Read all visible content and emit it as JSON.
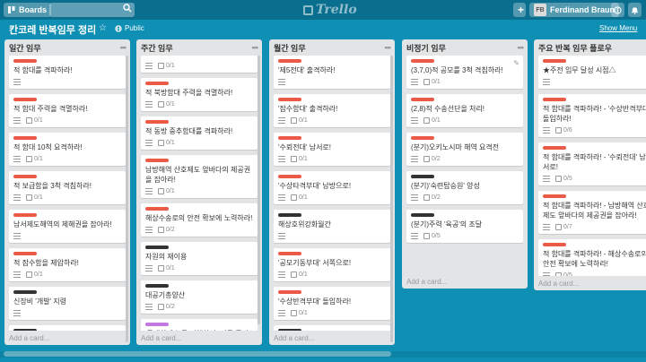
{
  "topbar": {
    "boards_label": "Boards",
    "logo_text": "Trello",
    "user_initials": "FB",
    "user_name": "Ferdinand Braun"
  },
  "board": {
    "title": "칸코레 반복임무 정리",
    "visibility": "Public",
    "show_menu": "Show Menu"
  },
  "add_card_label": "Add a card...",
  "lists": [
    {
      "name": "일간 임무",
      "cards": [
        {
          "label": "red",
          "title": "적 함대를 격파하라!",
          "desc": true,
          "check": null
        },
        {
          "label": "red",
          "title": "적 함대 주력을 격멸하라!",
          "desc": true,
          "check": "0/1"
        },
        {
          "label": "red",
          "title": "적 함대 10척 요격하라!",
          "desc": true,
          "check": "0/1"
        },
        {
          "label": "red",
          "title": "적 보급함을 3척 격침하라!",
          "desc": true,
          "check": "0/1"
        },
        {
          "label": "red",
          "title": "남서제도해역의 제해권을 잡아라!",
          "desc": true,
          "check": null
        },
        {
          "label": "red",
          "title": "적 잠수함을 제압하라!",
          "desc": true,
          "check": "0/1"
        },
        {
          "label": "black",
          "title": "신장비 '개발' 지령",
          "desc": true,
          "check": null
        },
        {
          "label": "black",
          "title": "신조함 '건조' 지령",
          "desc": false,
          "check": null
        }
      ]
    },
    {
      "name": "주간 임무",
      "cards": [
        {
          "label": null,
          "title": "",
          "desc": true,
          "check": "0/1"
        },
        {
          "label": "red",
          "title": "적 북방함대 주력을 격멸하라!",
          "desc": true,
          "check": "0/1"
        },
        {
          "label": "red",
          "title": "적 동방 중추함대를 격파하라!",
          "desc": true,
          "check": "0/1"
        },
        {
          "label": "red",
          "title": "남방해역 산호제도 앞바다의 제공권을 잡아라!",
          "desc": true,
          "check": "0/1"
        },
        {
          "label": "red",
          "title": "해상수송로의 안전 확보에 노력하라!",
          "desc": true,
          "check": "0/2"
        },
        {
          "label": "black",
          "title": "자원의 재이용",
          "desc": true,
          "check": "0/1"
        },
        {
          "label": "black",
          "title": "대공기총양산",
          "desc": true,
          "check": "0/2"
        },
        {
          "label": "purple",
          "title": "'근대화개수'를 진행하여, 전투 준비를 갖춰라!",
          "desc": false,
          "check": null
        }
      ]
    },
    {
      "name": "월간 임무",
      "cards": [
        {
          "label": "red",
          "title": "'제5전대' 출격하라!",
          "desc": true,
          "check": null
        },
        {
          "label": "red",
          "title": "'잠수함대' 출격하라!",
          "desc": true,
          "check": "0/1"
        },
        {
          "label": "red",
          "title": "'수뢰전대' 남서로!",
          "desc": true,
          "check": "0/1"
        },
        {
          "label": "red",
          "title": "'수상타격부대' 남방으로!",
          "desc": true,
          "check": "0/1"
        },
        {
          "label": "black",
          "title": "해상호위강화월간",
          "desc": true,
          "check": null
        },
        {
          "label": "red",
          "title": "'공모기동부대' 서쪽으로!",
          "desc": true,
          "check": "0/1"
        },
        {
          "label": "red",
          "title": "'수상반격부대' 돌입하라!",
          "desc": true,
          "check": "0/1"
        },
        {
          "label": "black",
          "title": "정예 '함전'대의 신 편성",
          "desc": false,
          "check": null
        }
      ]
    },
    {
      "name": "비정기 임무",
      "cards": [
        {
          "label": "red",
          "title": "(3,7,0)적 공모를 3척 격침하라!",
          "desc": true,
          "check": "0/1"
        },
        {
          "label": "red",
          "title": "(2,8)적 수송선단을 처리!",
          "desc": true,
          "check": "0/1"
        },
        {
          "label": "red",
          "title": "(분기)오키노시마 해역 요격전",
          "desc": true,
          "check": "0/2"
        },
        {
          "label": "black",
          "title": "(분기)'숙련탑승원' 양성",
          "desc": true,
          "check": "0/2"
        },
        {
          "label": "black",
          "title": "(분기)주력 '육공'의 조달",
          "desc": true,
          "check": "0/5"
        }
      ]
    },
    {
      "name": "주요 반복 임무 플로우",
      "cards": [
        {
          "label": "red",
          "title": "★주전 임무 달성 시점△",
          "desc": true,
          "check": null
        },
        {
          "label": "red",
          "title": "적 함대를 격파하라! - '수상반격부대' 돌입하라!",
          "desc": true,
          "check": "0/6"
        },
        {
          "label": "red",
          "title": "적 함대를 격파하라! - '수뢰전대' 남서로!",
          "desc": true,
          "check": "0/5"
        },
        {
          "label": "red",
          "title": "적 함대를 격파하라! - 남방해역 산호제도 앞바다의 제공권을 잡아라!",
          "desc": true,
          "check": "0/7"
        },
        {
          "label": "red",
          "title": "적 함대를 격파하라! - 해상수송로의 안전 확보에 노력하라!",
          "desc": true,
          "check": "0/5"
        }
      ]
    }
  ],
  "colors": {
    "board_bg": "#0f8fb3",
    "topbar_bg": "#0a6e8f",
    "list_bg": "#e2e4e6",
    "label_red": "#eb5a46",
    "label_black": "#333333",
    "label_purple": "#c377e0"
  },
  "icons": [
    "boards-icon",
    "search-icon",
    "trello-logo-icon",
    "plus-icon",
    "info-icon",
    "bell-icon",
    "star-icon",
    "globe-icon",
    "description-icon",
    "checklist-icon",
    "edit-icon"
  ]
}
